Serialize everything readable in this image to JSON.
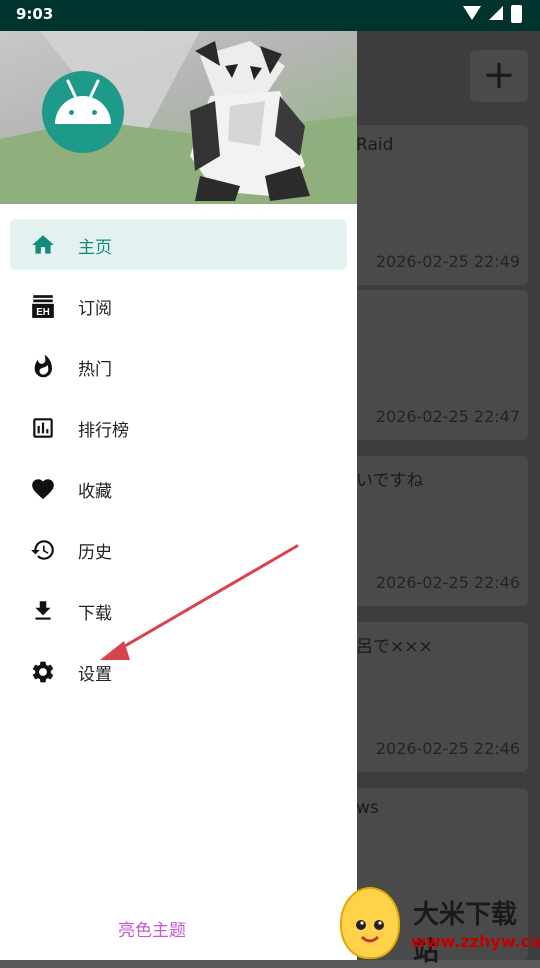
{
  "statusbar": {
    "time": "9:03"
  },
  "background": {
    "cards": [
      {
        "title": "Raid",
        "time": "2026-02-25 22:49"
      },
      {
        "title": "",
        "time": "2026-02-25 22:47"
      },
      {
        "title": "いですね",
        "time": "2026-02-25 22:46"
      },
      {
        "title": "呂で×××",
        "time": "2026-02-25 22:46"
      },
      {
        "title": "ws",
        "time": ""
      }
    ],
    "plus_symbol": "+"
  },
  "drawer": {
    "items": [
      {
        "label": "主页",
        "icon": "home-icon",
        "active": true
      },
      {
        "label": "订阅",
        "icon": "eh-subscribe-icon",
        "active": false
      },
      {
        "label": "热门",
        "icon": "fire-icon",
        "active": false
      },
      {
        "label": "排行榜",
        "icon": "bar-chart-icon",
        "active": false
      },
      {
        "label": "收藏",
        "icon": "heart-icon",
        "active": false
      },
      {
        "label": "历史",
        "icon": "history-icon",
        "active": false
      },
      {
        "label": "下载",
        "icon": "download-icon",
        "active": false
      },
      {
        "label": "设置",
        "icon": "gear-icon",
        "active": false
      }
    ],
    "theme_button": "亮色主题"
  },
  "watermark": {
    "title": "大米下载站",
    "url": "www.zzhyw.com"
  },
  "colors": {
    "accent": "#14897c",
    "active_bg": "#e3f2f1",
    "theme_text": "#c558d3",
    "arrow": "#d9434e"
  }
}
